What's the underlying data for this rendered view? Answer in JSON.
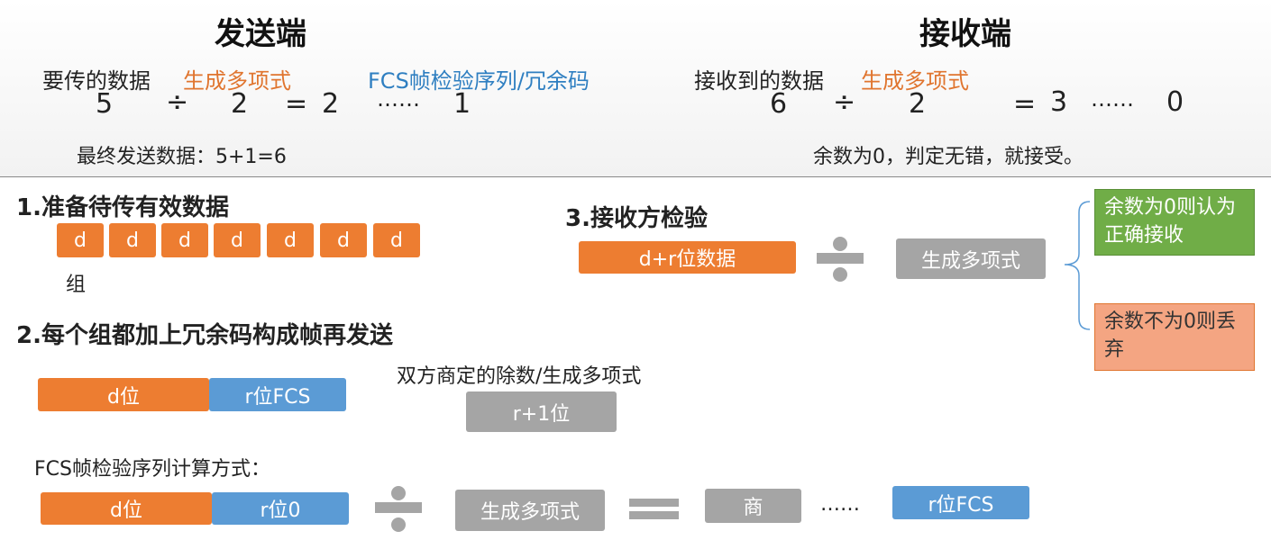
{
  "sender": {
    "title": "发送端",
    "label_data": "要传的数据",
    "label_poly": "生成多项式",
    "label_fcs": "FCS帧检验序列/冗余码",
    "dividend": "5",
    "div_sign": "÷",
    "divisor": "2",
    "equals": "=",
    "quotient": "2",
    "dots": "……",
    "remainder": "1",
    "final": "最终发送数据：5+1=6"
  },
  "receiver": {
    "title": "接收端",
    "label_data": "接收到的数据",
    "label_poly": "生成多项式",
    "dividend": "6",
    "div_sign": "÷",
    "divisor": "2",
    "equals": "=",
    "quotient": "3",
    "dots": "……",
    "remainder": "0",
    "conclusion": "余数为0，判定无错，就接受。"
  },
  "step1": {
    "title": "1.准备待传有效数据",
    "blocks": [
      "d",
      "d",
      "d",
      "d",
      "d",
      "d",
      "d"
    ],
    "group_label": "组"
  },
  "step2": {
    "title": "2.每个组都加上冗余码构成帧再发送",
    "d_bits": "d位",
    "r_fcs": "r位FCS",
    "divisor_caption": "双方商定的除数/生成多项式",
    "r_plus_1": "r+1位"
  },
  "fcs_calc": {
    "title": "FCS帧检验序列计算方式：",
    "d_bits": "d位",
    "r_zero": "r位0",
    "poly": "生成多项式",
    "quotient": "商",
    "dots": "……",
    "r_fcs": "r位FCS"
  },
  "step3": {
    "title": "3.接收方检验",
    "data_box": "d+r位数据",
    "poly": "生成多项式",
    "accept": "余数为0则认为正确接收",
    "reject": "余数不为0则丢弃"
  },
  "colors": {
    "orange": "#ed7d31",
    "blue": "#5b9bd5",
    "gray": "#a5a5a5",
    "green": "#70ad47",
    "salmon": "#f4a582"
  }
}
